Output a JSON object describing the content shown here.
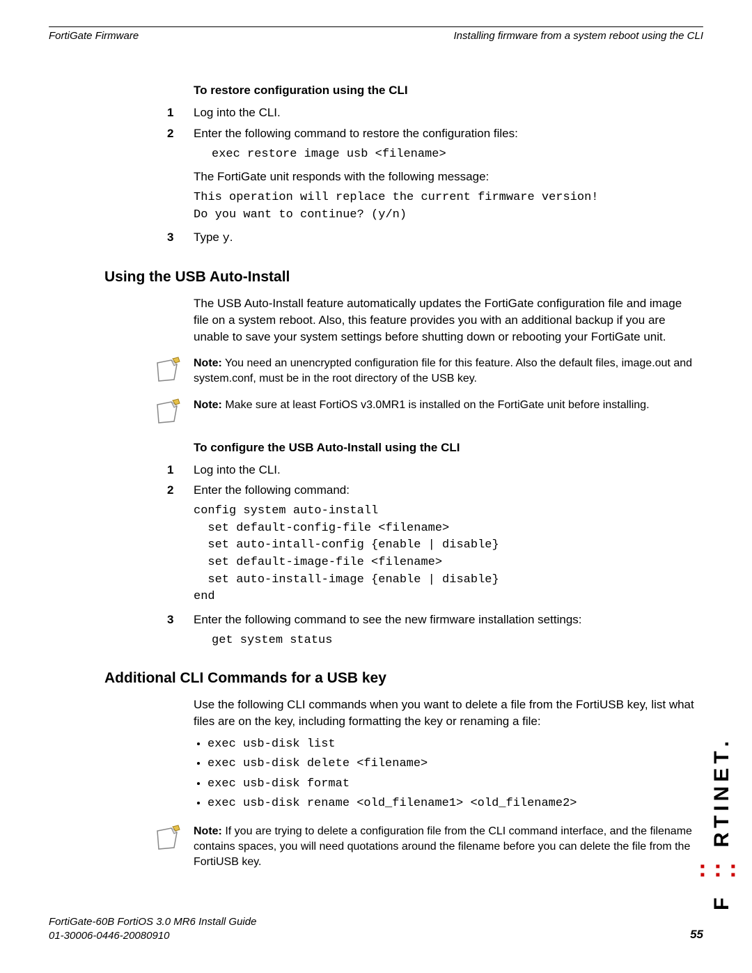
{
  "header": {
    "left": "FortiGate Firmware",
    "right": "Installing firmware from a system reboot using the CLI"
  },
  "proc1": {
    "title": "To restore configuration using the CLI",
    "s1": "Log into the CLI.",
    "s2": "Enter the following command to restore the configuration files:",
    "s2_code": "exec restore image usb <filename>",
    "s2_p2": "The FortiGate unit responds with the following message:",
    "s2_code2": "This operation will replace the current firmware version!\nDo you want to continue? (y/n)",
    "s3_a": "Type ",
    "s3_b": "y",
    "s3_c": "."
  },
  "sec2": {
    "heading": "Using the USB Auto-Install",
    "intro": "The USB Auto-Install feature automatically updates the FortiGate configuration file and image file on a system reboot. Also, this feature provides you with an additional backup if you are unable to save your system settings before shutting down or rebooting your FortiGate unit.",
    "note1_b": "Note:",
    "note1": " You need an unencrypted configuration file for this feature. Also the default files, image.out and system.conf, must be in the root directory of the USB key.",
    "note2_b": "Note:",
    "note2": " Make sure at least FortiOS v3.0MR1 is installed on the FortiGate unit before installing."
  },
  "proc2": {
    "title": "To configure the USB Auto-Install using the CLI",
    "s1": "Log into the CLI.",
    "s2": "Enter the following command:",
    "s2_code": "config system auto-install\n  set default-config-file <filename>\n  set auto-intall-config {enable | disable}\n  set default-image-file <filename>\n  set auto-install-image {enable | disable}\nend",
    "s3": "Enter the following command to see the new firmware installation settings:",
    "s3_code": "get system status"
  },
  "sec3": {
    "heading": "Additional CLI Commands for a USB key",
    "intro": "Use the following CLI commands when you want to delete a file from the FortiUSB key, list what files are on the key, including formatting the key or renaming a file:",
    "c1": "exec usb-disk list",
    "c2": "exec usb-disk delete <filename>",
    "c3": "exec usb-disk format",
    "c4": "exec usb-disk rename <old_filename1> <old_filename2>",
    "note_b": "Note:",
    "note": " If you are trying to delete a configuration file from the CLI command interface, and the filename contains spaces, you will need quotations around the filename before you can delete the file from the FortiUSB key."
  },
  "footer": {
    "l1": "FortiGate-60B FortiOS 3.0 MR6 Install Guide",
    "l2": "01-30006-0446-20080910",
    "page": "55"
  },
  "brand": "FORTINET"
}
